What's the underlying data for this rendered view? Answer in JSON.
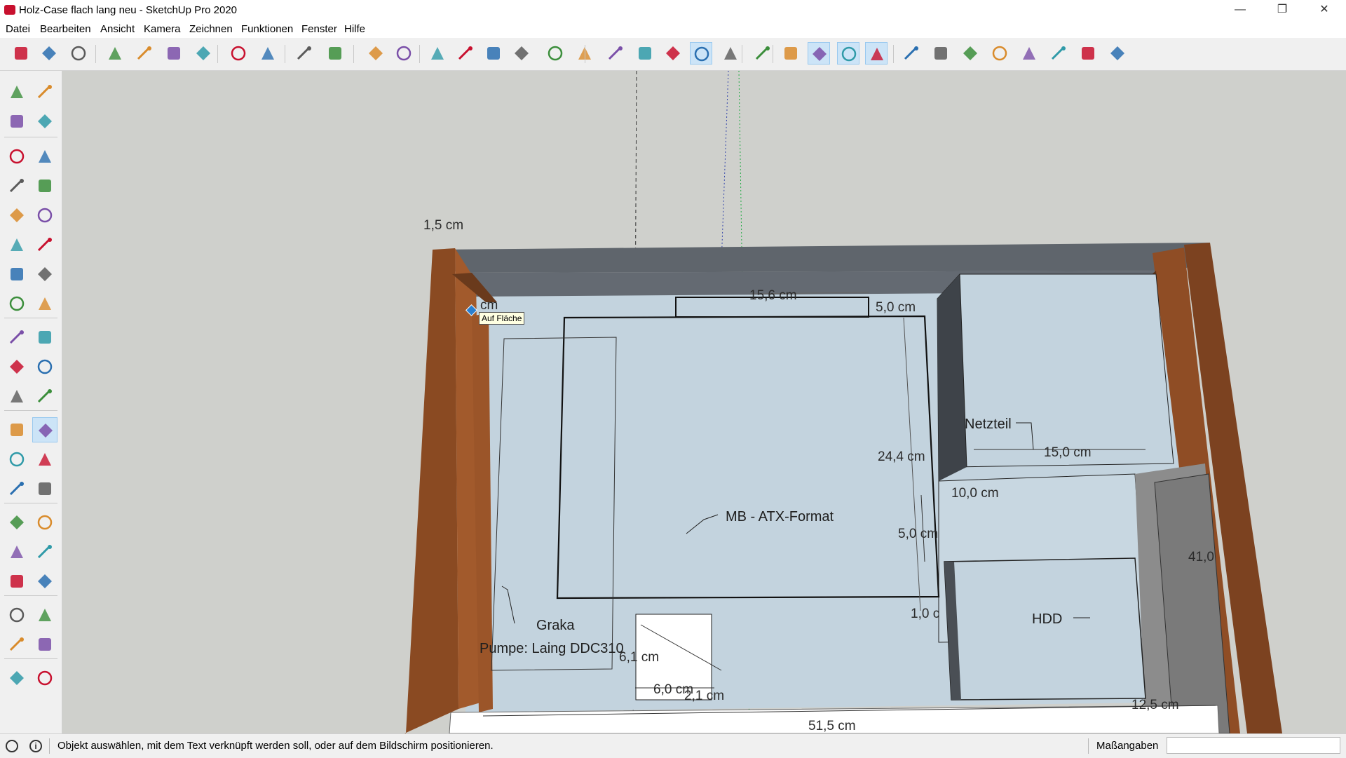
{
  "window": {
    "title": "Holz-Case flach lang neu - SketchUp Pro 2020",
    "controls": [
      "—",
      "❐",
      "✕"
    ]
  },
  "menu": [
    "Datei",
    "Bearbeiten",
    "Ansicht",
    "Kamera",
    "Zeichnen",
    "Funktionen",
    "Fenster",
    "Hilfe"
  ],
  "toolbar": {
    "icons": [
      "new-icon",
      "open-icon",
      "save-icon",
      "cut-icon",
      "copy-icon",
      "paste-icon",
      "erase-icon",
      "undo-icon",
      "redo-icon",
      "print-icon",
      "model-info-icon",
      "iso-view-icon",
      "top-view-icon",
      "front-view-icon",
      "right-view-icon",
      "back-view-icon",
      "left-view-icon",
      "xray-icon",
      "back-edges-icon",
      "wireframe-icon",
      "hidden-line-icon",
      "shaded-icon",
      "shaded-textures-icon",
      "monochrome-icon",
      "style-icon",
      "section-plane-icon",
      "section-display-icon",
      "section-cuts-icon",
      "component-options-icon",
      "sandbox-icon",
      "smoove-icon",
      "stamp-icon",
      "drape-icon",
      "add-detail-icon",
      "flip-edge-icon",
      "3d-warehouse-icon",
      "extension-icon"
    ],
    "selected": [
      "shaded-textures-icon",
      "section-display-icon",
      "section-cuts-icon",
      "component-options-icon"
    ]
  },
  "left_tools": [
    "select-icon",
    "make-component-icon",
    "paint-bucket-icon",
    "eraser-icon",
    "line-icon",
    "freehand-icon",
    "rectangle-icon",
    "rotated-rectangle-icon",
    "circle-icon",
    "polygon-icon",
    "arc-icon",
    "2-point-arc-icon",
    "3-point-arc-icon",
    "pie-icon",
    "move-icon",
    "push-pull-icon",
    "rotate-icon",
    "follow-me-icon",
    "scale-icon",
    "offset-icon",
    "tape-measure-icon",
    "dimension-icon",
    "protractor-icon",
    "text-icon",
    "axes-icon",
    "3d-text-icon",
    "orbit-icon",
    "pan-icon",
    "zoom-icon",
    "zoom-window-icon",
    "zoom-extents-icon",
    "previous-view-icon",
    "position-camera-icon",
    "look-around-icon",
    "walk-icon",
    "section-plane-tool-icon",
    "3d-warehouse-tool-icon",
    "extension-warehouse-icon",
    "layout-icon",
    "ruby-icon"
  ],
  "left_tools_selected": "text-icon",
  "scene": {
    "tooltip": "Auf Fläche",
    "dimensions": [
      "1,5 cm",
      "15,6 cm",
      "5,0 cm",
      "24,4 cm",
      "15,0 cm",
      "10,0 cm",
      "5,0 cm",
      "41,0",
      "1,0 c",
      "6,1 cm",
      "6,0 cm",
      "2,1 cm",
      "51,5 cm",
      "12,5 cm",
      "cm"
    ],
    "labels": [
      "Netzteil",
      "MB - ATX-Format",
      "Graka",
      "Pumpe: Laing DDC310",
      "HDD"
    ],
    "colors": {
      "wood": "#8b4a22",
      "panel": "#c3d3de",
      "dark_panel": "#636970",
      "background": "#cfd0cc"
    }
  },
  "status": {
    "text": "Objekt auswählen, mit dem Text verknüpft werden soll, oder auf dem Bildschirm positionieren.",
    "measure_label": "Maßangaben",
    "measure_value": ""
  }
}
